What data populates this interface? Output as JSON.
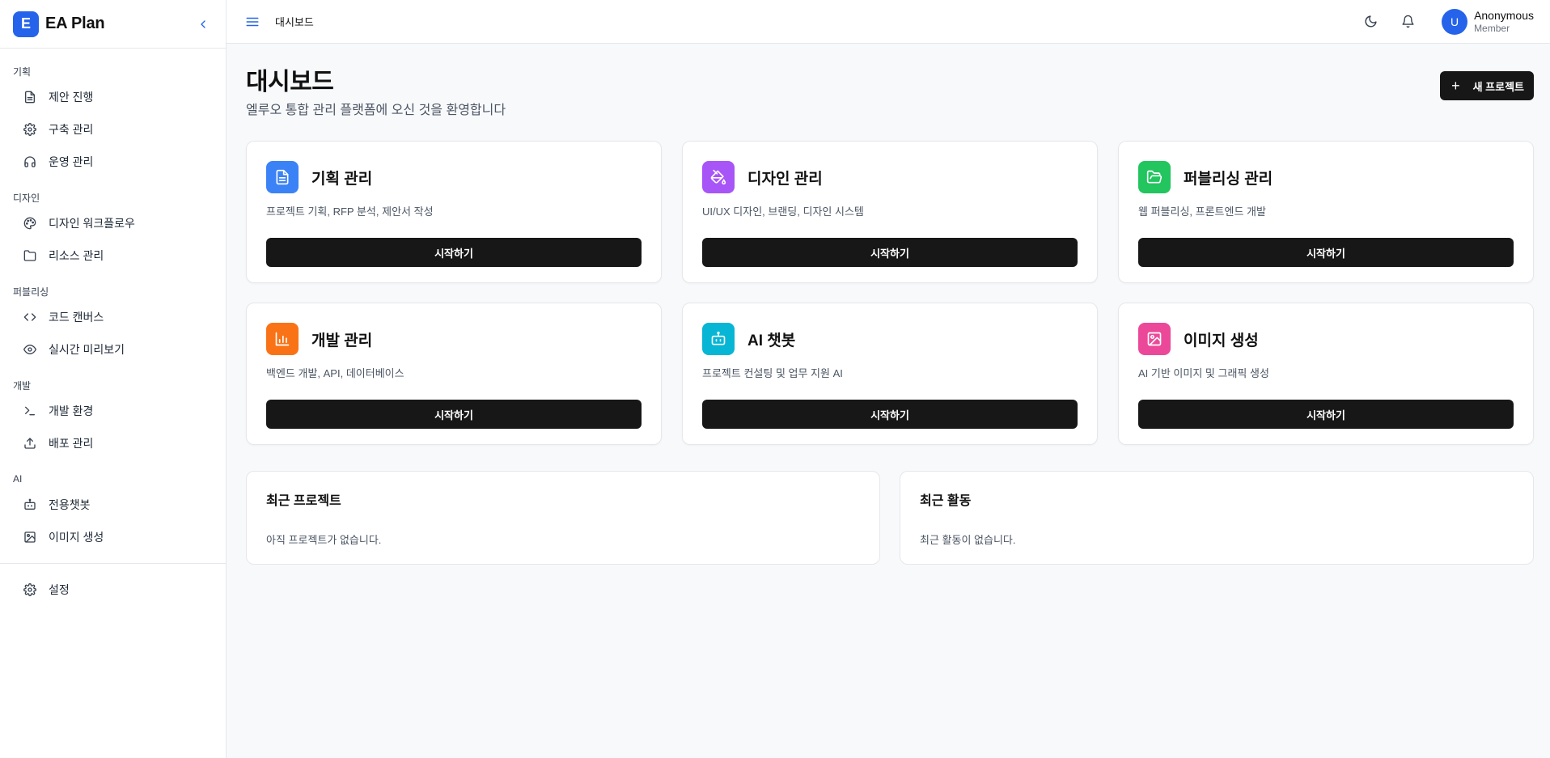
{
  "brand": {
    "logo_letter": "E",
    "name": "EA Plan"
  },
  "sidebar": {
    "sections": [
      {
        "title": "기획",
        "items": [
          {
            "label": "제안 진행",
            "icon": "file-text-icon"
          },
          {
            "label": "구축 관리",
            "icon": "gear-icon"
          },
          {
            "label": "운영 관리",
            "icon": "headphones-icon"
          }
        ]
      },
      {
        "title": "디자인",
        "items": [
          {
            "label": "디자인 워크플로우",
            "icon": "palette-icon"
          },
          {
            "label": "리소스 관리",
            "icon": "folder-icon"
          }
        ]
      },
      {
        "title": "퍼블리싱",
        "items": [
          {
            "label": "코드 캔버스",
            "icon": "code-icon"
          },
          {
            "label": "실시간 미리보기",
            "icon": "eye-icon"
          }
        ]
      },
      {
        "title": "개발",
        "items": [
          {
            "label": "개발 환경",
            "icon": "terminal-icon"
          },
          {
            "label": "배포 관리",
            "icon": "upload-icon"
          }
        ]
      },
      {
        "title": "AI",
        "items": [
          {
            "label": "전용챗봇",
            "icon": "bot-icon"
          },
          {
            "label": "이미지 생성",
            "icon": "image-icon"
          }
        ]
      }
    ],
    "settings_label": "설정"
  },
  "header": {
    "title": "대시보드",
    "user": {
      "initial": "U",
      "name": "Anonymous",
      "role": "Member"
    }
  },
  "page": {
    "title": "대시보드",
    "subtitle": "엘루오 통합 관리 플랫폼에 오신 것을 환영합니다",
    "new_project_label": "새 프로젝트"
  },
  "cards": [
    {
      "title": "기획 관리",
      "desc": "프로젝트 기획, RFP 분석, 제안서 작성",
      "button": "시작하기",
      "color": "#3b82f6",
      "icon": "file-text-icon"
    },
    {
      "title": "디자인 관리",
      "desc": "UI/UX 디자인, 브랜딩, 디자인 시스템",
      "button": "시작하기",
      "color": "#a855f7",
      "icon": "paint-bucket-icon"
    },
    {
      "title": "퍼블리싱 관리",
      "desc": "웹 퍼블리싱, 프론트엔드 개발",
      "button": "시작하기",
      "color": "#22c55e",
      "icon": "folder-open-icon"
    },
    {
      "title": "개발 관리",
      "desc": "백엔드 개발, API, 데이터베이스",
      "button": "시작하기",
      "color": "#f97316",
      "icon": "bar-chart-icon"
    },
    {
      "title": "AI 챗봇",
      "desc": "프로젝트 컨설팅 및 업무 지원 AI",
      "button": "시작하기",
      "color": "#06b6d4",
      "icon": "bot-icon"
    },
    {
      "title": "이미지 생성",
      "desc": "AI 기반 이미지 및 그래픽 생성",
      "button": "시작하기",
      "color": "#ec4899",
      "icon": "image-icon"
    }
  ],
  "panels": {
    "recent_projects": {
      "title": "최근 프로젝트",
      "empty": "아직 프로젝트가 없습니다."
    },
    "recent_activity": {
      "title": "최근 활동",
      "empty": "최근 활동이 없습니다."
    }
  }
}
